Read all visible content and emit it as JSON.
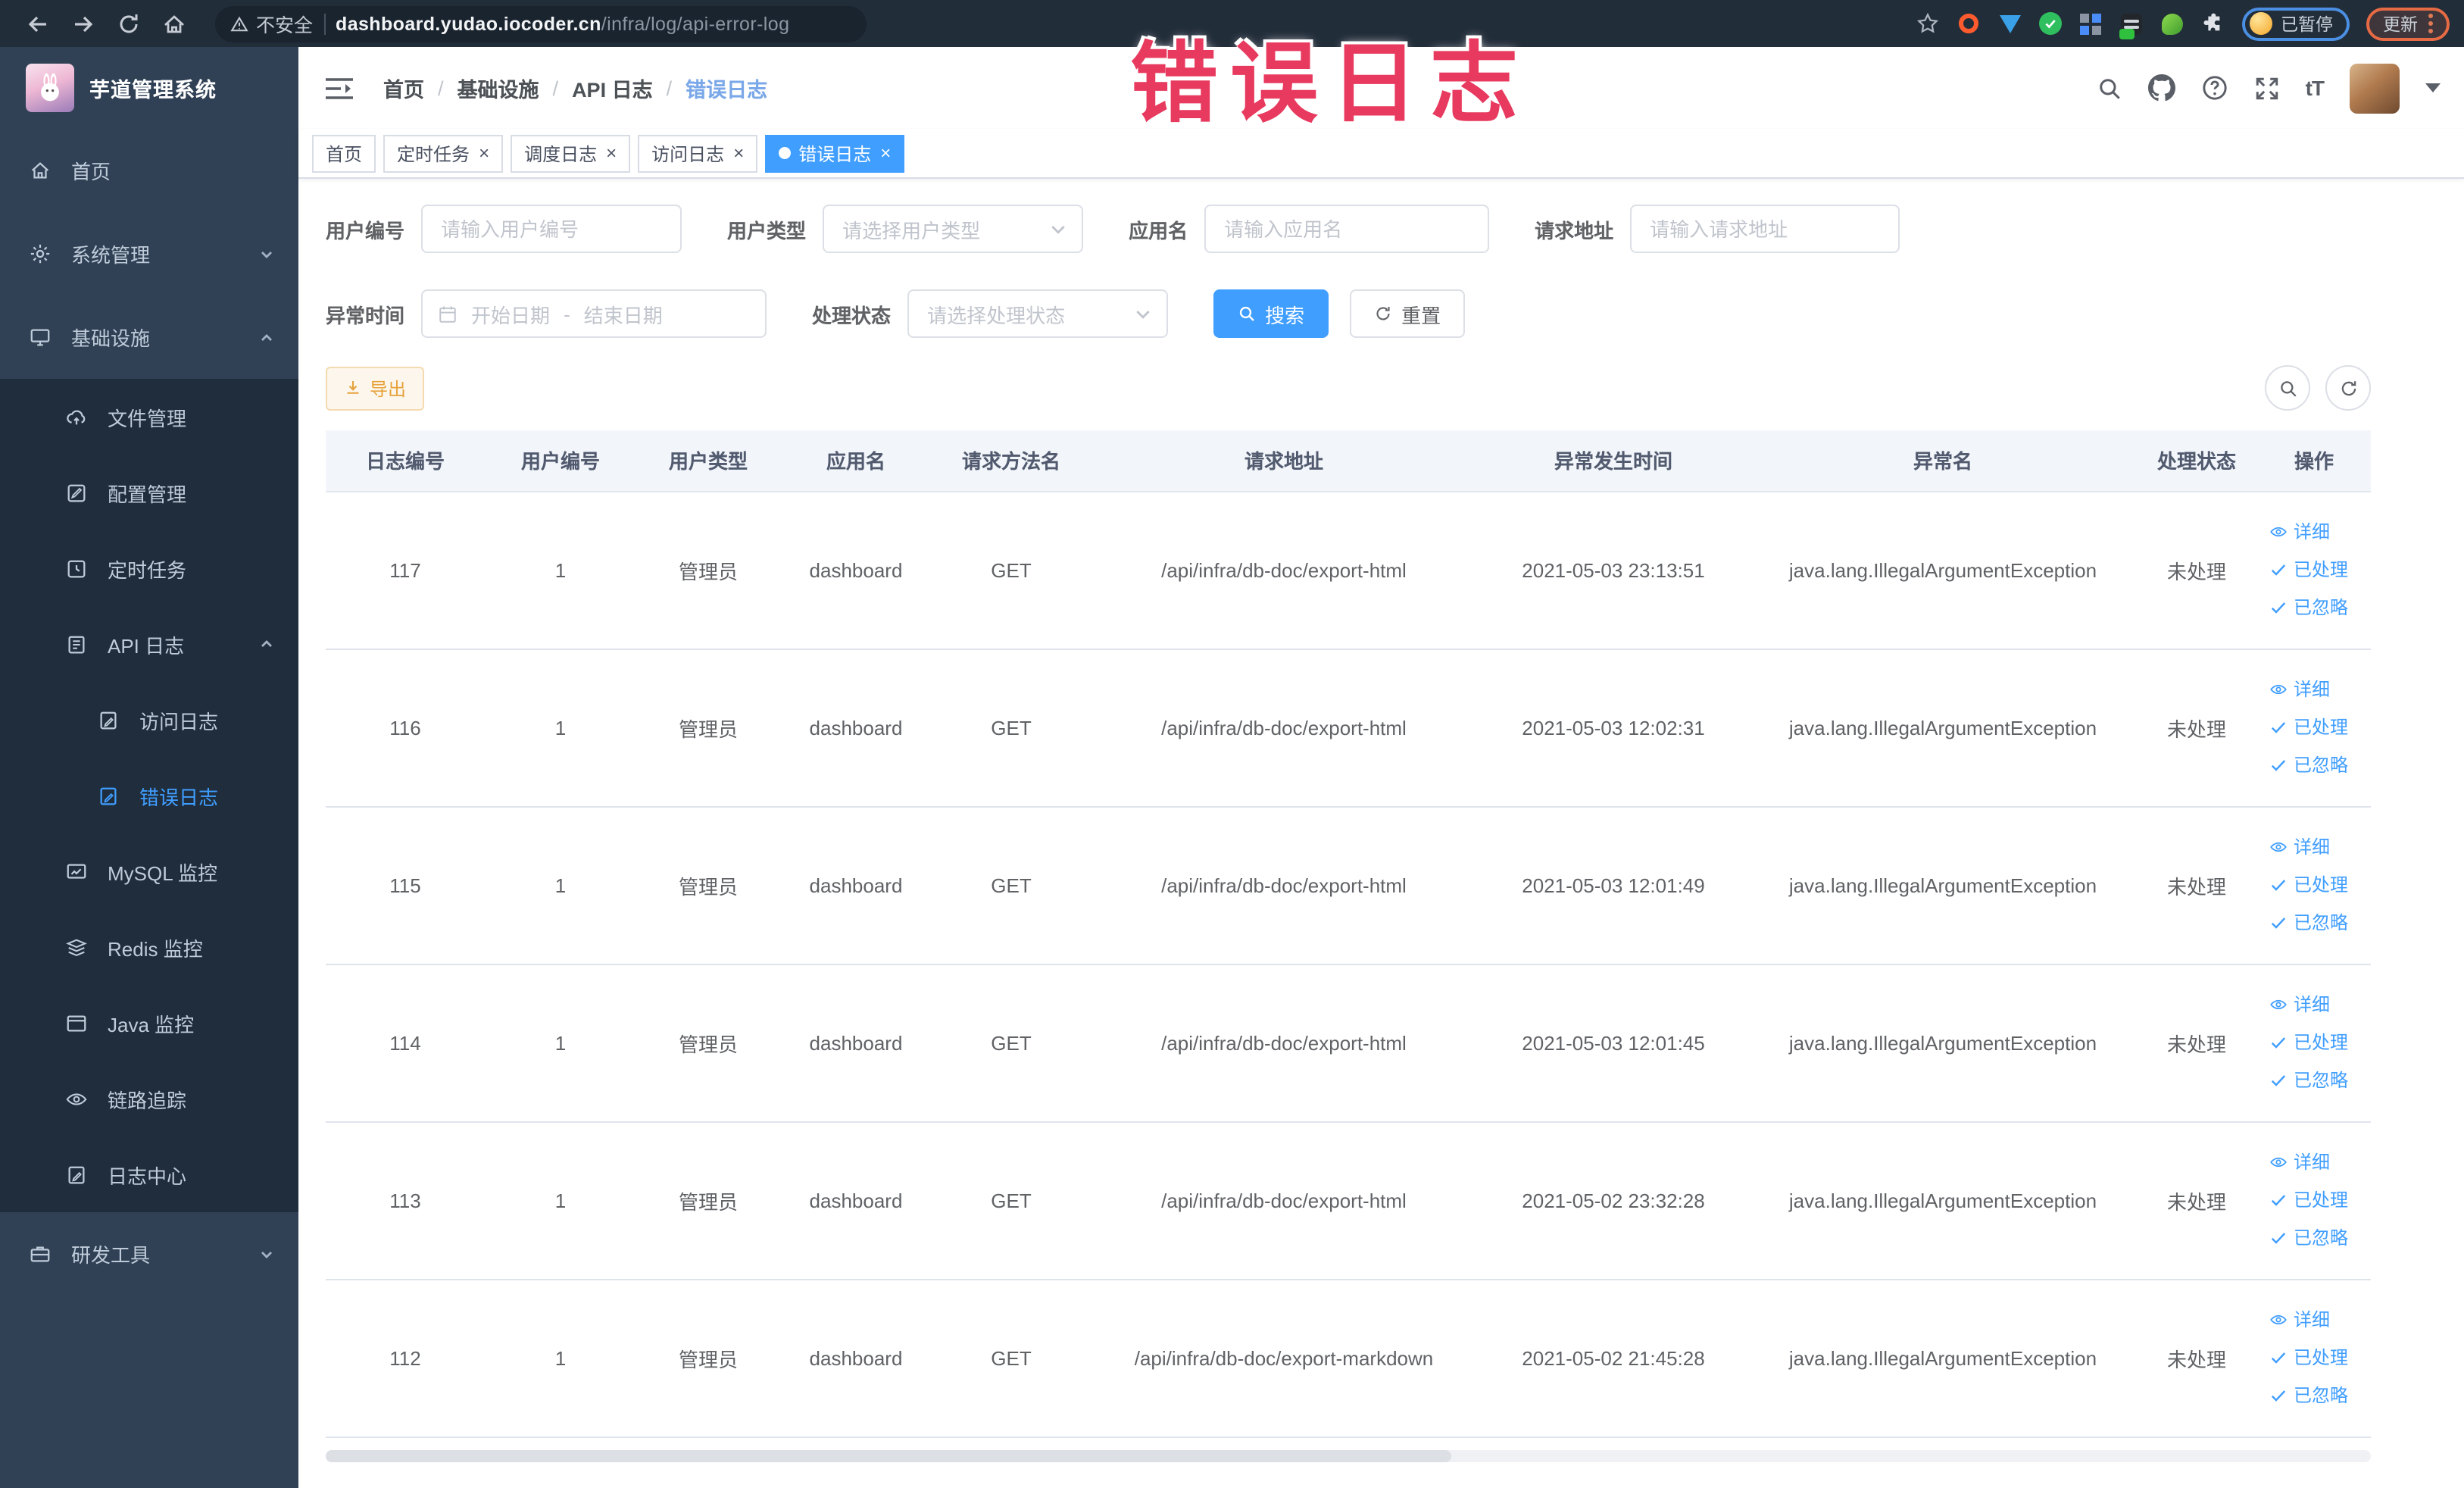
{
  "browser": {
    "security_label": "不安全",
    "url_domain": "dashboard.yudao.iocoder.cn",
    "url_path": "/infra/log/api-error-log",
    "paused_label": "已暂停",
    "update_label": "更新"
  },
  "header": {
    "app_title": "芋道管理系统",
    "breadcrumb": {
      "home": "首页",
      "section": "基础设施",
      "parent": "API 日志",
      "current": "错误日志"
    },
    "text_size_icon_label": "tT"
  },
  "annotation": {
    "text": "错误日志",
    "color": "#E8395E"
  },
  "tabs": {
    "items": [
      {
        "label": "首页"
      },
      {
        "label": "定时任务"
      },
      {
        "label": "调度日志"
      },
      {
        "label": "访问日志"
      },
      {
        "label": "错误日志"
      }
    ]
  },
  "sidebar": {
    "items": [
      {
        "label": "首页"
      },
      {
        "label": "系统管理"
      },
      {
        "label": "基础设施"
      },
      {
        "label": "文件管理"
      },
      {
        "label": "配置管理"
      },
      {
        "label": "定时任务"
      },
      {
        "label": "API 日志"
      },
      {
        "label": "访问日志"
      },
      {
        "label": "错误日志"
      },
      {
        "label": "MySQL 监控"
      },
      {
        "label": "Redis 监控"
      },
      {
        "label": "Java 监控"
      },
      {
        "label": "链路追踪"
      },
      {
        "label": "日志中心"
      },
      {
        "label": "研发工具"
      }
    ]
  },
  "filters": {
    "user_id": {
      "label": "用户编号",
      "placeholder": "请输入用户编号"
    },
    "user_type": {
      "label": "用户类型",
      "placeholder": "请选择用户类型"
    },
    "app_name": {
      "label": "应用名",
      "placeholder": "请输入应用名"
    },
    "request_url": {
      "label": "请求地址",
      "placeholder": "请输入请求地址"
    },
    "exception_time": {
      "label": "异常时间",
      "start_placeholder": "开始日期",
      "separator": "-",
      "end_placeholder": "结束日期"
    },
    "process_status": {
      "label": "处理状态",
      "placeholder": "请选择处理状态"
    },
    "search_label": "搜索",
    "reset_label": "重置"
  },
  "toolbar": {
    "export_label": "导出"
  },
  "table": {
    "columns": [
      "日志编号",
      "用户编号",
      "用户类型",
      "应用名",
      "请求方法名",
      "请求地址",
      "异常发生时间",
      "异常名",
      "处理状态",
      "操作"
    ],
    "row_actions": [
      {
        "label": "详细"
      },
      {
        "label": "已处理"
      },
      {
        "label": "已忽略"
      }
    ],
    "rows": [
      {
        "id": "117",
        "user_id": "1",
        "user_type": "管理员",
        "app_name": "dashboard",
        "method": "GET",
        "url": "/api/infra/db-doc/export-html",
        "time": "2021-05-03 23:13:51",
        "exception": "java.lang.IllegalArgumentException",
        "status": "未处理"
      },
      {
        "id": "116",
        "user_id": "1",
        "user_type": "管理员",
        "app_name": "dashboard",
        "method": "GET",
        "url": "/api/infra/db-doc/export-html",
        "time": "2021-05-03 12:02:31",
        "exception": "java.lang.IllegalArgumentException",
        "status": "未处理"
      },
      {
        "id": "115",
        "user_id": "1",
        "user_type": "管理员",
        "app_name": "dashboard",
        "method": "GET",
        "url": "/api/infra/db-doc/export-html",
        "time": "2021-05-03 12:01:49",
        "exception": "java.lang.IllegalArgumentException",
        "status": "未处理"
      },
      {
        "id": "114",
        "user_id": "1",
        "user_type": "管理员",
        "app_name": "dashboard",
        "method": "GET",
        "url": "/api/infra/db-doc/export-html",
        "time": "2021-05-03 12:01:45",
        "exception": "java.lang.IllegalArgumentException",
        "status": "未处理"
      },
      {
        "id": "113",
        "user_id": "1",
        "user_type": "管理员",
        "app_name": "dashboard",
        "method": "GET",
        "url": "/api/infra/db-doc/export-html",
        "time": "2021-05-02 23:32:28",
        "exception": "java.lang.IllegalArgumentException",
        "status": "未处理"
      },
      {
        "id": "112",
        "user_id": "1",
        "user_type": "管理员",
        "app_name": "dashboard",
        "method": "GET",
        "url": "/api/infra/db-doc/export-markdown",
        "time": "2021-05-02 21:45:28",
        "exception": "java.lang.IllegalArgumentException",
        "status": "未处理"
      }
    ]
  },
  "colors": {
    "accent": "#409EFF",
    "sidebar_bg": "#304156",
    "submenu_bg": "#1F2D3D",
    "warning": "#E6A23C",
    "annotation_red": "#E8395E"
  }
}
